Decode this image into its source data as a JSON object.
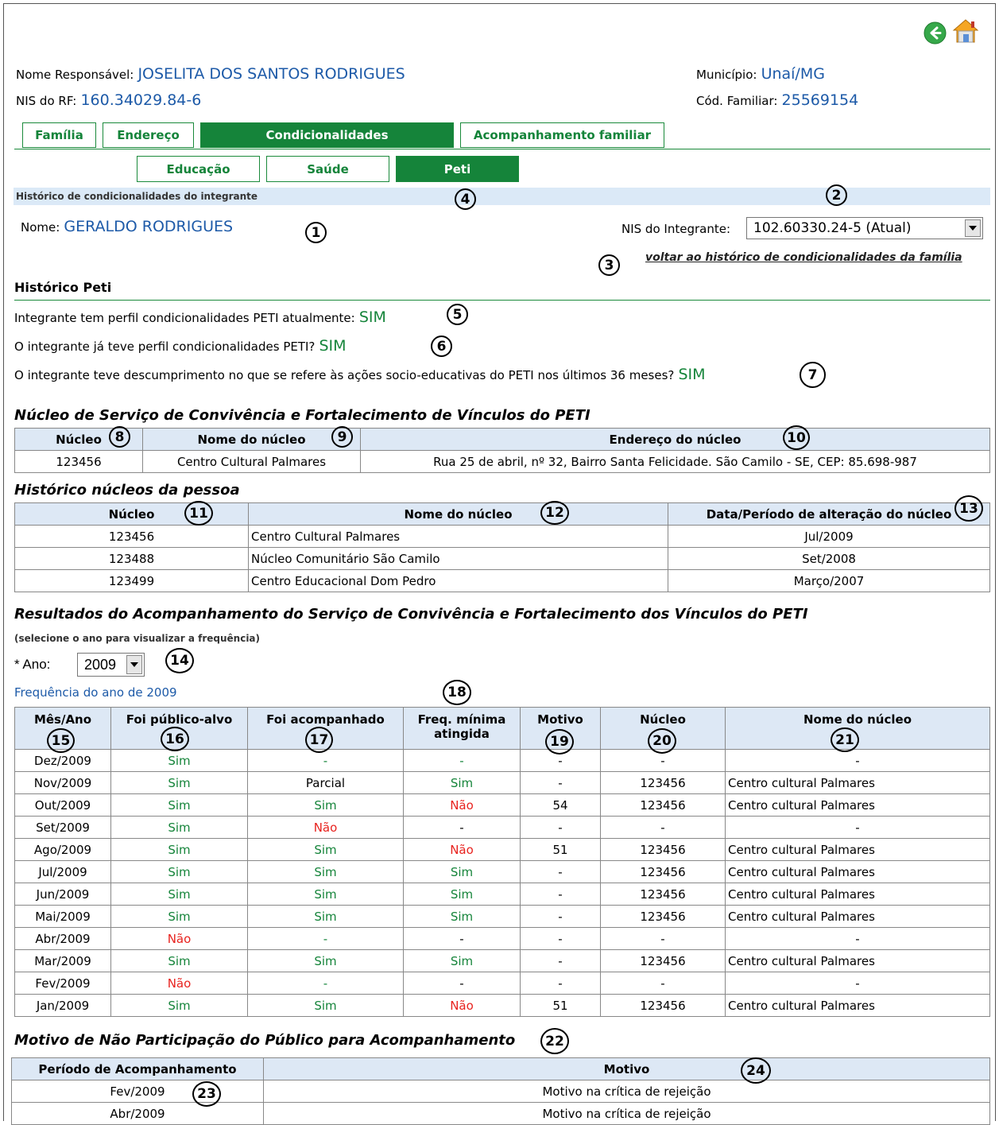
{
  "header": {
    "nome_responsavel_label": "Nome Responsável:",
    "nome_responsavel": "JOSELITA DOS SANTOS RODRIGUES",
    "nis_rf_label": "NIS do RF:",
    "nis_rf": "160.34029.84-6",
    "municipio_label": "Município:",
    "municipio": "Unaí/MG",
    "cod_familiar_label": "Cód. Familiar:",
    "cod_familiar": "25569154"
  },
  "tabs": [
    "Família",
    "Endereço",
    "Condicionalidades",
    "Acompanhamento familiar"
  ],
  "subtabs": [
    "Educação",
    "Saúde",
    "Peti"
  ],
  "section_bar": "Histórico de condicionalidades do integrante",
  "integrante": {
    "nome_label": "Nome:",
    "nome": "GERALDO RODRIGUES",
    "nis_label": "NIS do Integrante:",
    "nis_selected": "102.60330.24-5 (Atual)",
    "voltar_link": "voltar ao histórico de condicionalidades da família"
  },
  "historico": {
    "title": "Histórico Peti",
    "q1": "Integrante tem perfil condicionalidades PETI atualmente:",
    "a1": "SIM",
    "q2": "O integrante já teve perfil condicionalidades PETI?",
    "a2": "SIM",
    "q3": "O integrante teve descumprimento no que se refere às ações socio-educativas do PETI  nos últimos 36 meses?",
    "a3": "SIM"
  },
  "nucleo_servico": {
    "title": "Núcleo de Serviço de Convivência e Fortalecimento de Vínculos do PETI",
    "headers": [
      "Núcleo",
      "Nome do núcleo",
      "Endereço do núcleo"
    ],
    "row": [
      "123456",
      "Centro Cultural Palmares",
      "Rua 25 de abril, nº 32, Bairro Santa Felicidade. São Camilo - SE, CEP: 85.698-987"
    ]
  },
  "historico_nucleos": {
    "title": "Histórico núcleos da pessoa",
    "headers": [
      "Núcleo",
      "Nome do núcleo",
      "Data/Período de alteração do núcleo"
    ],
    "rows": [
      [
        "123456",
        "Centro Cultural Palmares",
        "Jul/2009"
      ],
      [
        "123488",
        "Núcleo Comunitário São Camilo",
        "Set/2008"
      ],
      [
        "123499",
        "Centro Educacional Dom Pedro",
        "Março/2007"
      ]
    ]
  },
  "resultados": {
    "title": "Resultados do Acompanhamento do Serviço de Convivência e Fortalecimento dos Vínculos do PETI",
    "hint": "(selecione o ano para visualizar a frequência)",
    "ano_label": "* Ano:",
    "ano_selected": "2009",
    "freq_title": "Frequência do ano de 2009",
    "headers": [
      "Mês/Ano",
      "Foi público-alvo",
      "Foi acompanhado",
      "Freq. mínima atingida",
      "Motivo",
      "Núcleo",
      "Nome do núcleo"
    ],
    "rows": [
      [
        "Dez/2009",
        "Sim",
        "-",
        "-",
        "-",
        "-",
        "-"
      ],
      [
        "Nov/2009",
        "Sim",
        "Parcial",
        "Sim",
        "-",
        "123456",
        "Centro cultural Palmares"
      ],
      [
        "Out/2009",
        "Sim",
        "Sim",
        "Não",
        "54",
        "123456",
        "Centro cultural Palmares"
      ],
      [
        "Set/2009",
        "Sim",
        "Não",
        "-",
        "-",
        "-",
        "-"
      ],
      [
        "Ago/2009",
        "Sim",
        "Sim",
        "Não",
        "51",
        "123456",
        "Centro cultural Palmares"
      ],
      [
        "Jul/2009",
        "Sim",
        "Sim",
        "Sim",
        "-",
        "123456",
        "Centro cultural Palmares"
      ],
      [
        "Jun/2009",
        "Sim",
        "Sim",
        "Sim",
        "-",
        "123456",
        "Centro cultural Palmares"
      ],
      [
        "Mai/2009",
        "Sim",
        "Sim",
        "Sim",
        "-",
        "123456",
        "Centro cultural Palmares"
      ],
      [
        "Abr/2009",
        "Não",
        "-",
        "-",
        "-",
        "-",
        "-"
      ],
      [
        "Mar/2009",
        "Sim",
        "Sim",
        "Sim",
        "-",
        "123456",
        "Centro cultural Palmares"
      ],
      [
        "Fev/2009",
        "Não",
        "-",
        "-",
        "-",
        "-",
        "-"
      ],
      [
        "Jan/2009",
        "Sim",
        "Sim",
        "Não",
        "51",
        "123456",
        "Centro cultural Palmares"
      ]
    ]
  },
  "motivo_nao": {
    "title": "Motivo de Não Participação do Público para Acompanhamento",
    "headers": [
      "Período de Acompanhamento",
      "Motivo"
    ],
    "rows": [
      [
        "Fev/2009",
        "Motivo na crítica de rejeição"
      ],
      [
        "Abr/2009",
        "Motivo na crítica de rejeição"
      ]
    ]
  },
  "markers": [
    "1",
    "2",
    "3",
    "4",
    "5",
    "6",
    "7",
    "8",
    "9",
    "10",
    "11",
    "12",
    "13",
    "14",
    "15",
    "16",
    "17",
    "18",
    "19",
    "20",
    "21",
    "22",
    "23",
    "24"
  ],
  "icons": [
    "back-arrow-icon",
    "home-icon"
  ],
  "colors": {
    "accent": "#15843a",
    "value_blue": "#1d5aa8",
    "header_bg": "#dde8f5",
    "no_red": "#e8231f"
  }
}
